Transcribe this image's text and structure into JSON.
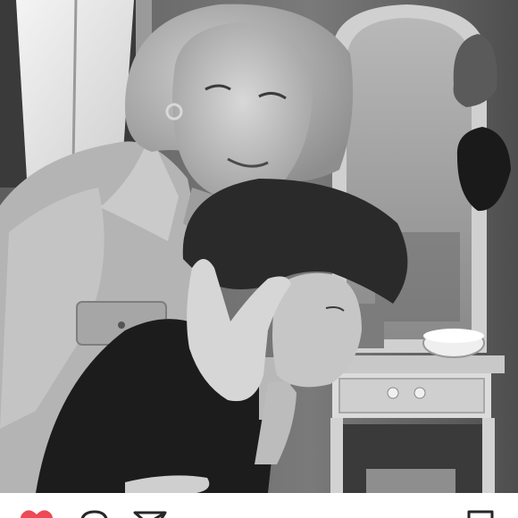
{
  "post": {
    "photo": {
      "kind": "black-and-white photograph",
      "filter": "grayscale"
    },
    "actions": {
      "like": {
        "icon": "heart-icon",
        "state": "liked",
        "color": "#ed4956"
      },
      "comment": {
        "icon": "comment-icon"
      },
      "share": {
        "icon": "share-icon"
      },
      "save": {
        "icon": "bookmark-icon"
      }
    }
  }
}
